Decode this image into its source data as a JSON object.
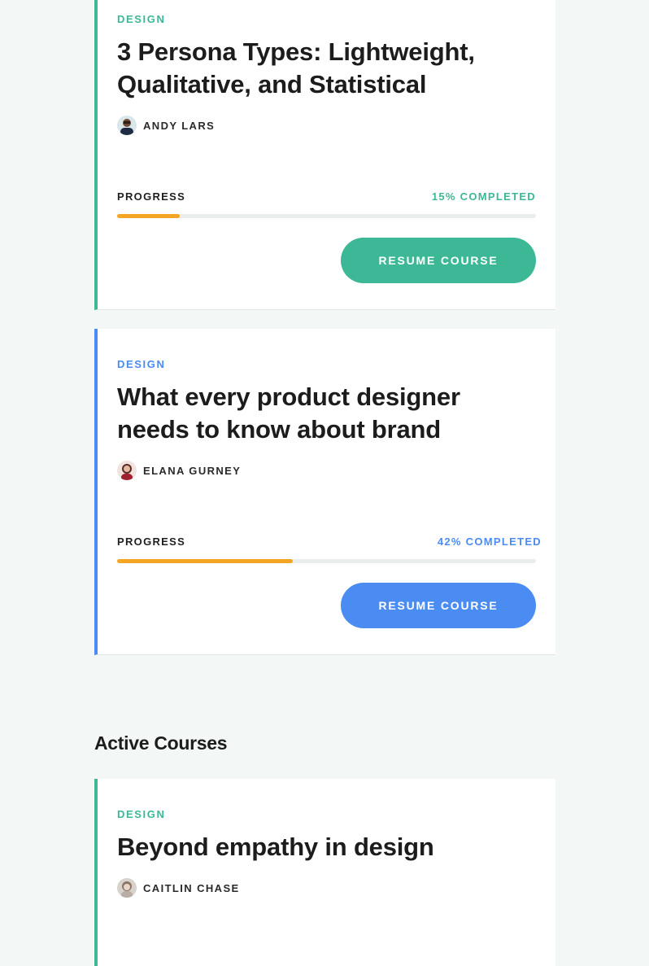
{
  "courses": [
    {
      "category": "DESIGN",
      "title": "3 Persona Types: Lightweight, Qualitative, and Statistical",
      "author": "ANDY LARS",
      "progress_label": "PROGRESS",
      "progress_text": "15% COMPLETED",
      "progress_percent": 15,
      "button_label": "RESUME COURSE",
      "accent": "#3cb896"
    },
    {
      "category": "DESIGN",
      "title": "What every product designer needs to know about brand",
      "author": "ELANA GURNEY",
      "progress_label": "PROGRESS",
      "progress_text": "42% COMPLETED",
      "progress_percent": 42,
      "button_label": "RESUME COURSE",
      "accent": "#4a8cf2"
    }
  ],
  "active_section": {
    "heading": "Active Courses",
    "courses": [
      {
        "category": "DESIGN",
        "title": "Beyond empathy in design",
        "author": "CAITLIN CHASE",
        "accent": "#3cb896"
      }
    ]
  },
  "colors": {
    "progress_fill": "#f5a524",
    "progress_track": "#e9eeec",
    "background": "#f3f7f6"
  },
  "icons": {
    "avatar_1": "avatar-andy-lars",
    "avatar_2": "avatar-elana-gurney",
    "avatar_3": "avatar-caitlin-chase"
  }
}
